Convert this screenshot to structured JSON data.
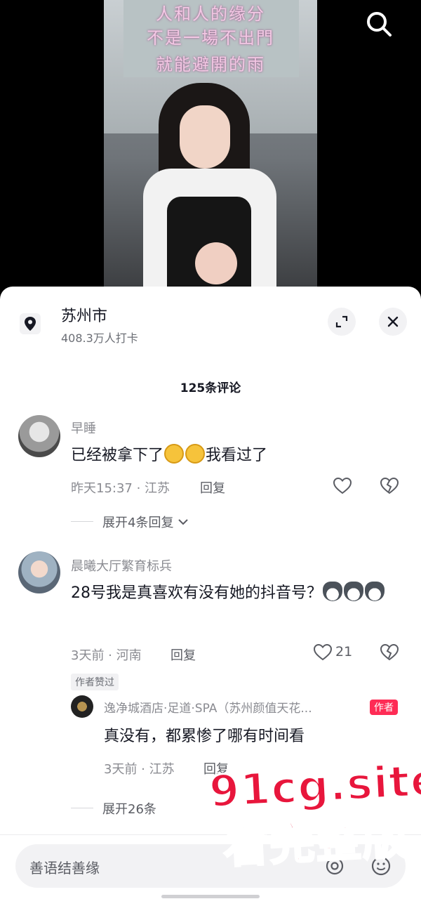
{
  "video": {
    "lyrics": [
      "人和人的缘分",
      "不是一場不出門",
      "就能避開的雨"
    ]
  },
  "location": {
    "title": "苏州市",
    "checkins": "408.3万人打卡"
  },
  "comments_header": "125条评论",
  "comments": [
    {
      "name": "早睡",
      "text_before": "已经被拿下了",
      "text_after": "我看过了",
      "meta": "昨天15:37 · 江苏",
      "reply_label": "回复",
      "expand_label": "展开4条回复"
    },
    {
      "name": "晨曦大厅繁育标兵",
      "text": "28号我是真喜欢有没有她的抖音号？",
      "meta": "3天前 · 河南",
      "reply_label": "回复",
      "like_count": "21",
      "liked_tag": "作者赞过",
      "sub_reply": {
        "name": "逸净城酒店·足道·SPA（苏州颜值天花...",
        "badge": "作者",
        "text": "真没有，都累惨了哪有时间看",
        "meta": "3天前 · 江苏",
        "reply_label": "回复"
      },
      "expand_label": "展开26条"
    }
  ],
  "input": {
    "placeholder": "善语结善缘"
  },
  "watermark": {
    "line1": "91cg.site",
    "line2": "看完整版"
  },
  "colors": {
    "accent": "#fe2c55",
    "watermark": "#e8163c"
  }
}
